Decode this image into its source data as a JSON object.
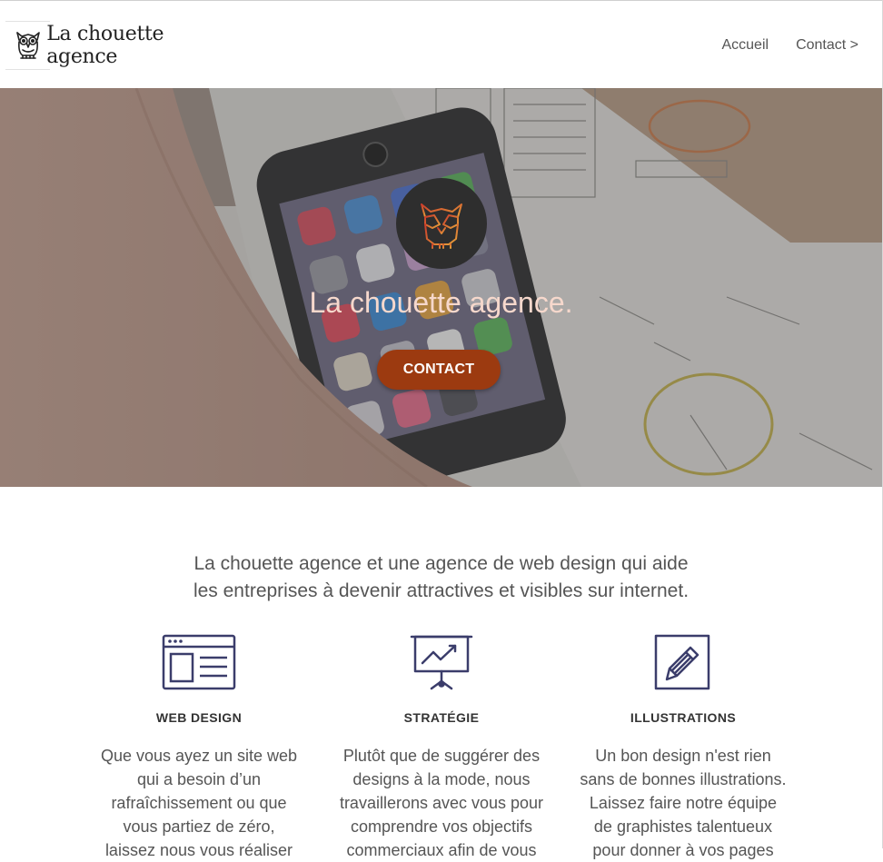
{
  "header": {
    "logo_text": "La chouette agence",
    "nav": [
      {
        "label": "Accueil"
      },
      {
        "label": "Contact >"
      }
    ]
  },
  "hero": {
    "title": "La chouette agence.",
    "button_label": "CONTACT"
  },
  "intro": {
    "line1": "La chouette agence et une agence de web design qui aide",
    "line2": "les entreprises à devenir attractives et visibles sur internet."
  },
  "services": [
    {
      "icon": "web-design-icon",
      "title": "WEB DESIGN",
      "lines": [
        "Que vous ayez un site web",
        "qui a besoin d’un",
        "rafraîchissement ou que",
        "vous partiez de zéro,",
        "laissez nous vous réaliser"
      ]
    },
    {
      "icon": "strategy-presentation-icon",
      "title": "STRATÉGIE",
      "lines": [
        "Plutôt que de suggérer des",
        "designs à la mode, nous",
        "travaillerons avec vous pour",
        "comprendre vos objectifs",
        "commerciaux afin de vous"
      ]
    },
    {
      "icon": "pencil-icon",
      "title": "ILLUSTRATIONS",
      "lines": [
        "Un bon design n'est rien",
        "sans de bonnes illustrations.",
        "Laissez faire notre équipe",
        "de graphistes talentueux",
        "pour donner à vos pages"
      ]
    }
  ],
  "colors": {
    "accent": "#9c3a10",
    "hero_title": "#f6d8cc",
    "icon_navy": "#3b3d6b",
    "owl_gradient_start": "#c93a2b",
    "owl_gradient_end": "#e8a33a"
  }
}
